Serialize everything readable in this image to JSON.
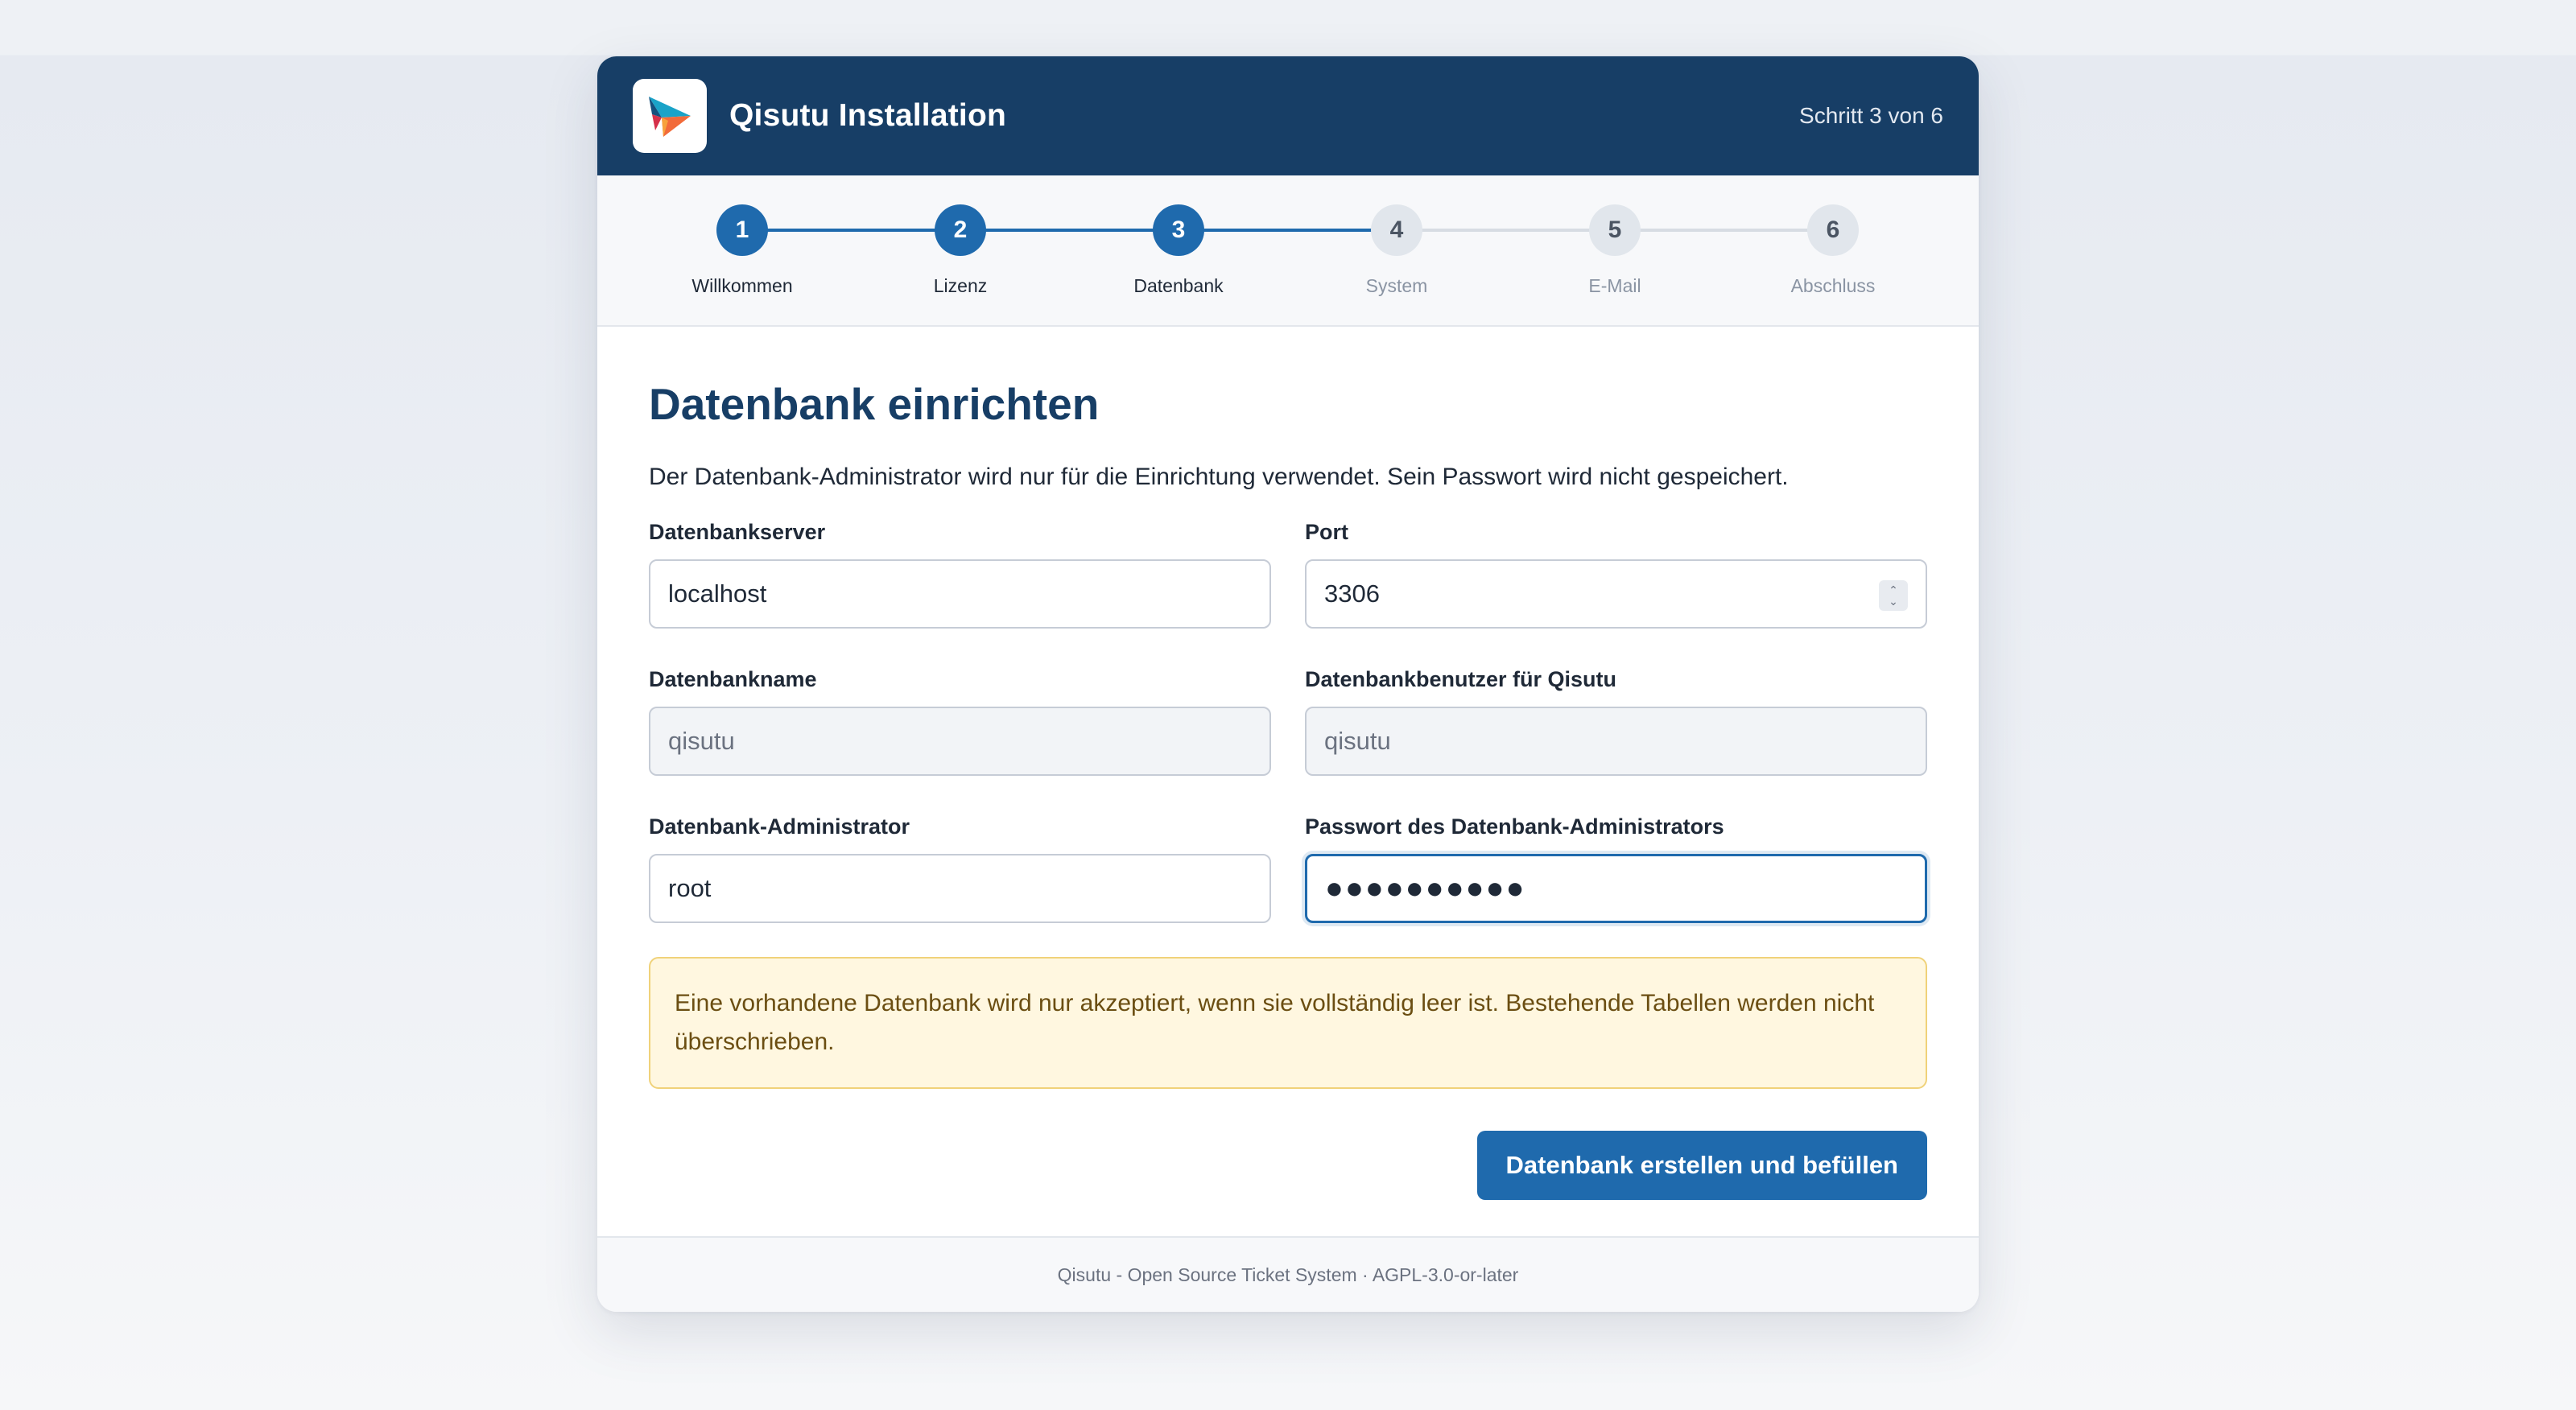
{
  "header": {
    "title": "Qisutu Installation",
    "step_counter": "Schritt 3 von 6"
  },
  "stepper": {
    "steps": [
      {
        "number": "1",
        "label": "Willkommen",
        "state": "done"
      },
      {
        "number": "2",
        "label": "Lizenz",
        "state": "done"
      },
      {
        "number": "3",
        "label": "Datenbank",
        "state": "current"
      },
      {
        "number": "4",
        "label": "System",
        "state": "todo"
      },
      {
        "number": "5",
        "label": "E-Mail",
        "state": "todo"
      },
      {
        "number": "6",
        "label": "Abschluss",
        "state": "todo"
      }
    ]
  },
  "main": {
    "title": "Datenbank einrichten",
    "intro": "Der Datenbank-Administrator wird nur für die Einrichtung verwendet. Sein Passwort wird nicht gespeichert.",
    "fields": {
      "db_server": {
        "label": "Datenbankserver",
        "value": "localhost"
      },
      "port": {
        "label": "Port",
        "value": "3306"
      },
      "db_name": {
        "label": "Datenbankname",
        "value": "qisutu"
      },
      "db_user": {
        "label": "Datenbankbenutzer für Qisutu",
        "value": "qisutu"
      },
      "db_admin": {
        "label": "Datenbank-Administrator",
        "value": "root"
      },
      "db_admin_password": {
        "label": "Passwort des Datenbank-Administrators",
        "value": "●●●●●●●●●●"
      }
    },
    "notice": "Eine vorhandene Datenbank wird nur akzeptiert, wenn sie vollständig leer ist. Bestehende Tabellen werden nicht überschrieben.",
    "submit_label": "Datenbank erstellen und befüllen"
  },
  "footer": {
    "text": "Qisutu - Open Source Ticket System · AGPL-3.0-or-later"
  },
  "colors": {
    "header_bg": "#173e66",
    "accent": "#1f6aad",
    "notice_bg": "#fff7e0",
    "notice_border": "#f0d27a"
  }
}
